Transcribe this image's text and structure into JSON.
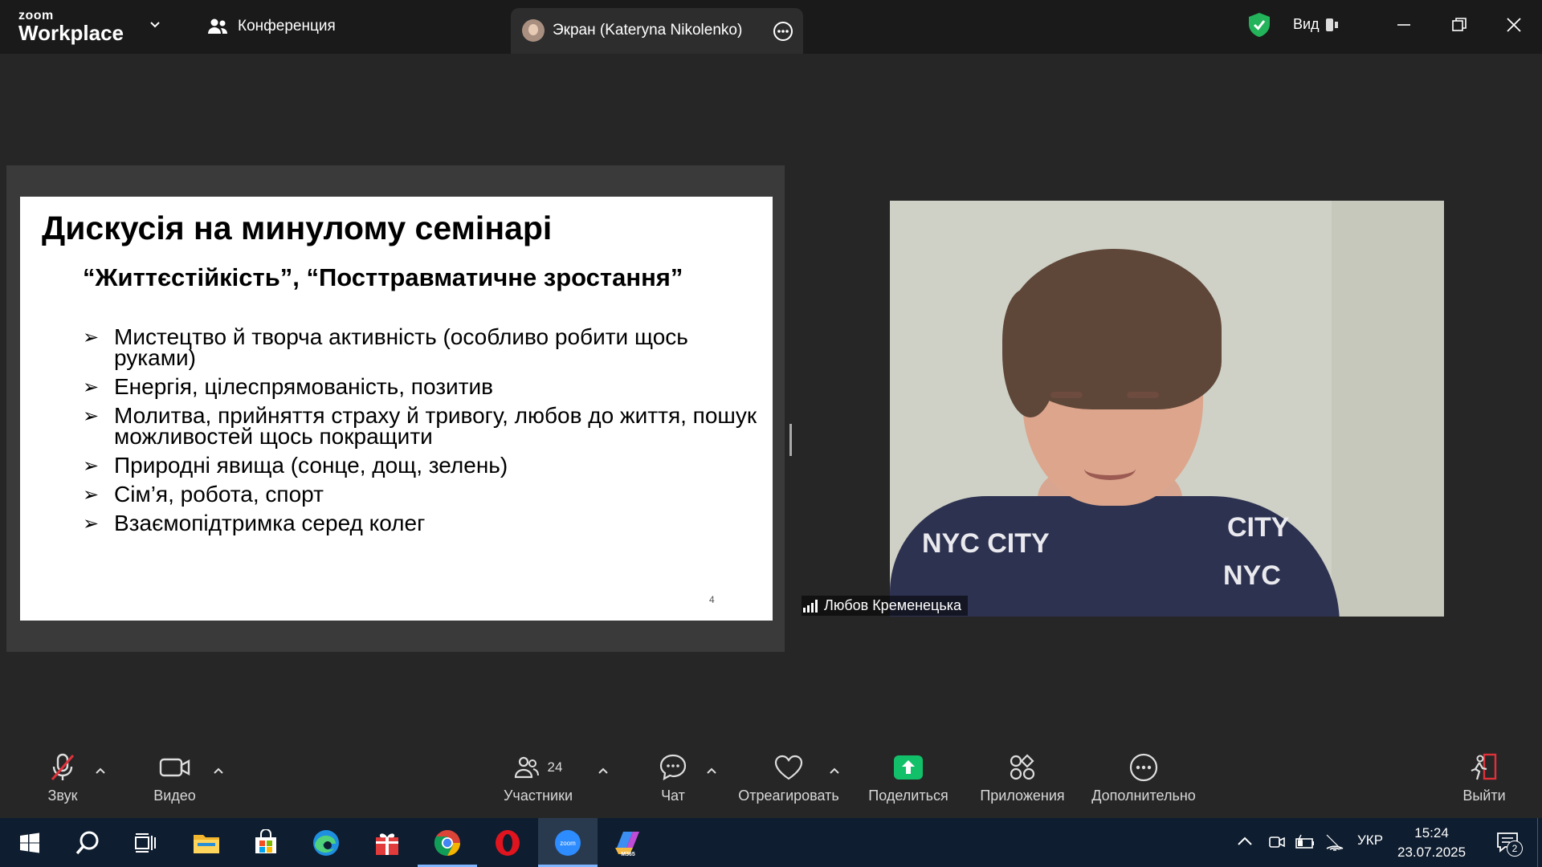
{
  "titlebar": {
    "logo_top": "zoom",
    "logo_bottom": "Workplace",
    "conference_label": "Конференция",
    "screen_tab_label": "Экран (Kateryna Nikolenko)",
    "view_label": "Вид",
    "icons": [
      "chevron-down-icon",
      "people-icon",
      "more-icon",
      "shield-check-icon",
      "minimize-icon",
      "restore-icon",
      "close-icon"
    ]
  },
  "slide": {
    "title": "Дискусія на минулому семінарі",
    "subtitle": "“Життєстійкість”, “Посттравматичне зростання”",
    "bullets": [
      "Мистецтво й творча активність (особливо робити щось руками)",
      "Енергія, цілеспрямованість, позитив",
      "Молитва, прийняття страху й тривогу, любов до життя, пошук можливостей щось покращити",
      "Природні явища (сонце, дощ, зелень)",
      "Сім’я, робота, спорт",
      "Взаємопідтримка серед колег"
    ],
    "bullet_marker": "➢",
    "page_number": "4"
  },
  "participant": {
    "name": "Любов Кременецька",
    "shirt_text": [
      "NYC CITY",
      "CITY",
      "NYC"
    ]
  },
  "toolbar": {
    "audio": "Звук",
    "video": "Видео",
    "participants": "Участники",
    "participants_count": "24",
    "chat": "Чат",
    "react": "Отреагировать",
    "share": "Поделиться",
    "apps": "Приложения",
    "more": "Дополнительно",
    "leave": "Выйти"
  },
  "taskbar": {
    "apps": [
      "windows-start",
      "search",
      "task-view",
      "file-explorer",
      "microsoft-store",
      "edge",
      "gift",
      "chrome",
      "opera",
      "zoom",
      "m365-copilot"
    ],
    "m365_label": "M365",
    "zoom_label": "zoom",
    "language": "УКР",
    "time": "15:24",
    "date": "23.07.2025",
    "notification_count": "2"
  },
  "colors": {
    "titlebar_bg": "#1a1a1a",
    "main_bg": "#262626",
    "share_green": "#13c06a",
    "mute_red": "#e0313b",
    "taskbar_bg": "#0e1d2f"
  }
}
